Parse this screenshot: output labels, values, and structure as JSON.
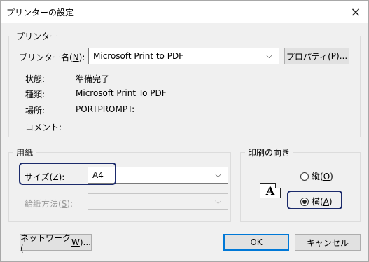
{
  "window": {
    "title": "プリンターの設定",
    "close_glyph": "×"
  },
  "printer": {
    "group_label": "プリンター",
    "name_label": "プリンター名(",
    "name_key": "N",
    "name_label_end": "):",
    "name_value": "Microsoft Print to PDF",
    "properties_label": "プロパティ(",
    "properties_key": "P",
    "properties_label_end": ")...",
    "status_label": "状態:",
    "status_value": "準備完了",
    "type_label": "種類:",
    "type_value": "Microsoft Print To PDF",
    "where_label": "場所:",
    "where_value": "PORTPROMPT:",
    "comment_label": "コメント:"
  },
  "paper": {
    "group_label": "用紙",
    "size_label": "サイズ(",
    "size_key": "Z",
    "size_label_end": "):",
    "size_value": "A4",
    "source_label": "給紙方法(",
    "source_key": "S",
    "source_label_end": "):",
    "source_value": ""
  },
  "orientation": {
    "group_label": "印刷の向き",
    "icon_letter": "A",
    "portrait_label": "縦(",
    "portrait_key": "O",
    "portrait_label_end": ")",
    "landscape_label": "横(",
    "landscape_key": "A",
    "landscape_label_end": ")",
    "selected": "landscape"
  },
  "footer": {
    "network_label": "ネットワーク(",
    "network_key": "W",
    "network_label_end": ")...",
    "ok_label": "OK",
    "cancel_label": "キャンセル"
  },
  "colors": {
    "highlight": "#1b2a6b",
    "default_button_border": "#0078d7"
  }
}
